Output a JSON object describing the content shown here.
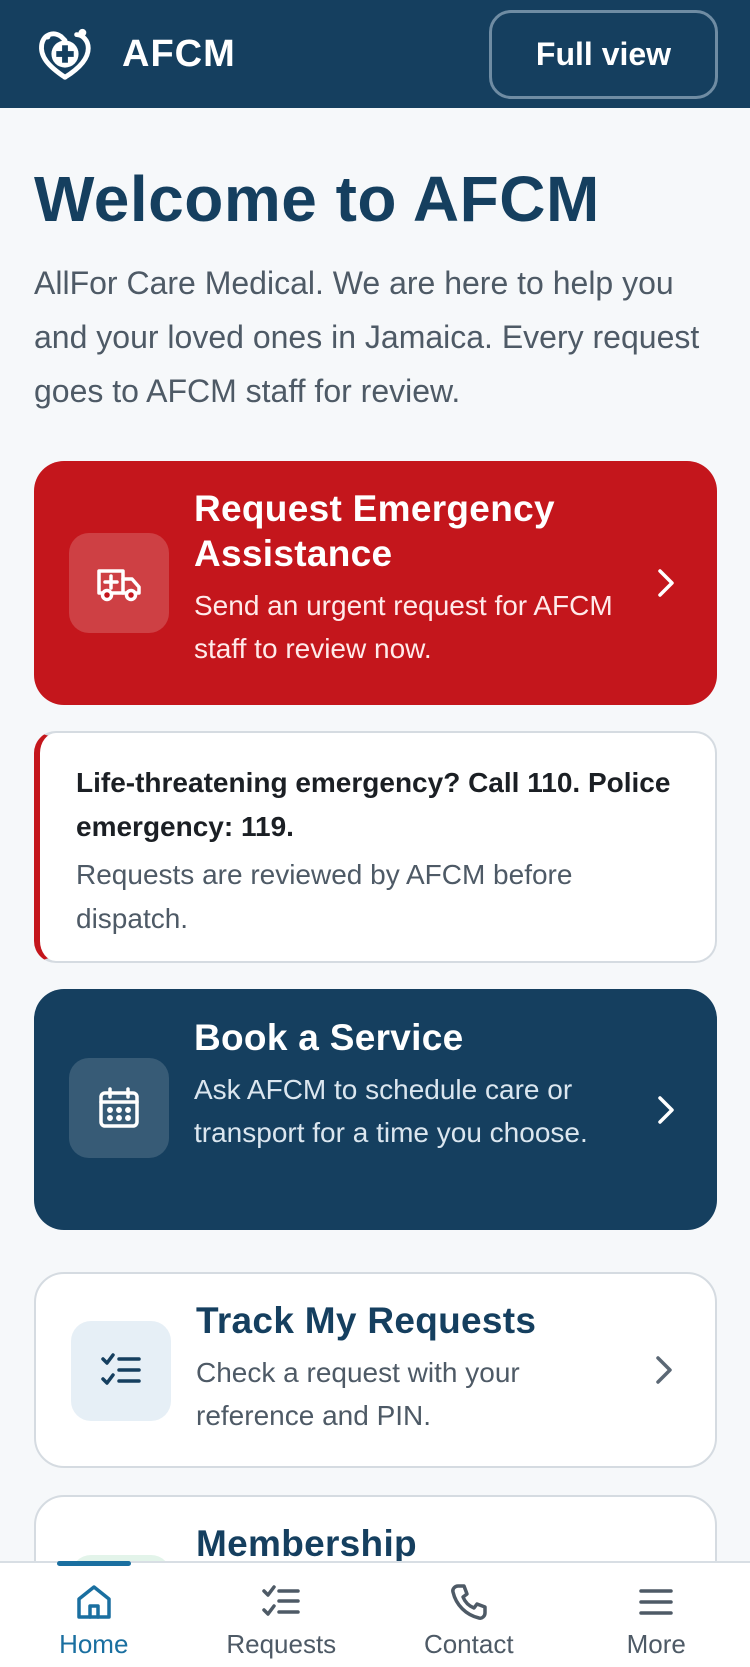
{
  "header": {
    "brand": "AFCM",
    "full_view_label": "Full view"
  },
  "welcome": {
    "title": "Welcome to AFCM",
    "intro": "AllFor Care Medical. We are here to help you and your loved ones in Jamaica. Every request goes to AFCM staff for review."
  },
  "cards": {
    "emergency": {
      "title": "Request Emergency Assistance",
      "desc": "Send an urgent request for AFCM staff to review now.",
      "icon": "ambulance-icon"
    },
    "notice": {
      "strong": "Life-threatening emergency? Call 110. Police emergency: 119.",
      "text": "Requests are reviewed by AFCM before dispatch."
    },
    "book": {
      "title": "Book a Service",
      "desc": "Ask AFCM to schedule care or transport for a time you choose.",
      "icon": "calendar-icon"
    },
    "track": {
      "title": "Track My Requests",
      "desc": "Check a request with your reference and PIN.",
      "icon": "checklist-icon"
    },
    "membership": {
      "title": "Membership"
    }
  },
  "nav": {
    "home": "Home",
    "requests": "Requests",
    "contact": "Contact",
    "more": "More"
  },
  "colors": {
    "primary": "#153f5f",
    "emergency": "#c4161c",
    "active": "#1a6fa0"
  }
}
